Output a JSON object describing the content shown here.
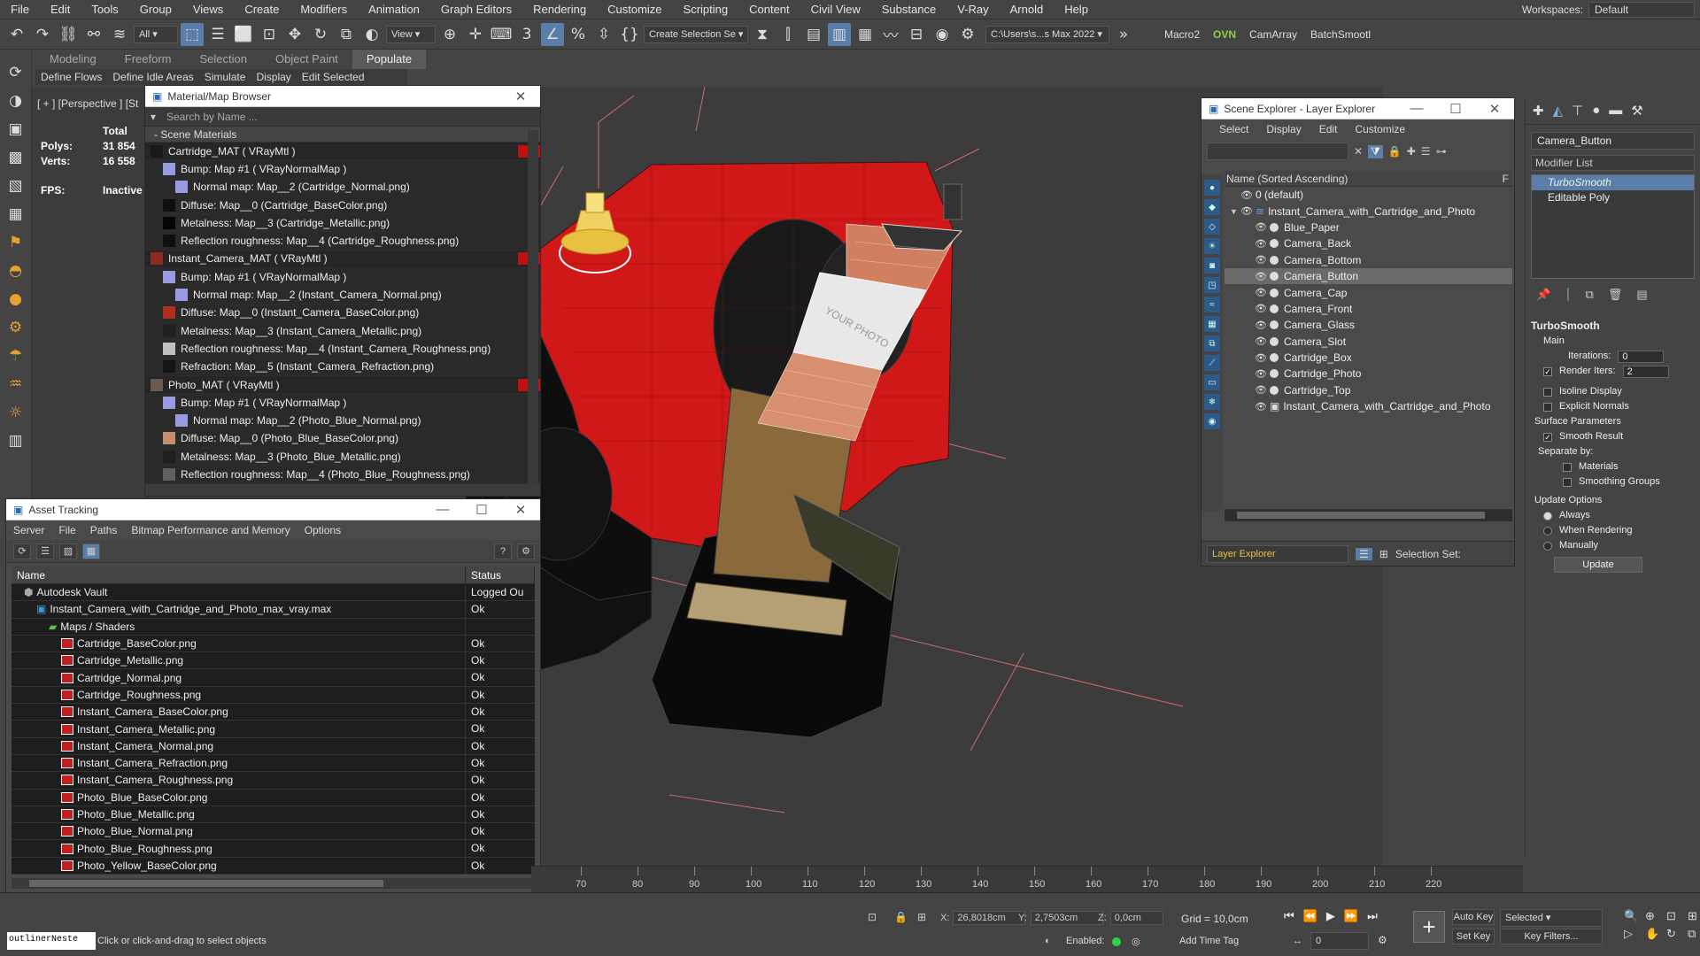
{
  "menubar": {
    "items": [
      "File",
      "Edit",
      "Tools",
      "Group",
      "Views",
      "Create",
      "Modifiers",
      "Animation",
      "Graph Editors",
      "Rendering",
      "Customize",
      "Scripting",
      "Content",
      "Civil View",
      "Substance",
      "V-Ray",
      "Arnold",
      "Help"
    ],
    "workspaces_label": "Workspaces:",
    "workspaces_value": "Default"
  },
  "toolbar": {
    "filter_value": "All",
    "view_value": "View",
    "selection_set": "Create Selection Se",
    "project_path": "C:\\Users\\s...s Max 2022",
    "macro2": "Macro2",
    "ovn": "OVN",
    "camarray": "CamArray",
    "batchsmooth": "BatchSmootl"
  },
  "ribbon": {
    "tabs": [
      "Modeling",
      "Freeform",
      "Selection",
      "Object Paint",
      "Populate"
    ],
    "active_tab": "Populate",
    "subtabs": [
      "Define Flows",
      "Define Idle Areas",
      "Simulate",
      "Display",
      "Edit Selected"
    ]
  },
  "viewport": {
    "label": "[ + ] [Perspective ] [St",
    "stats": {
      "total_label": "Total",
      "polys_label": "Polys:",
      "polys_value": "31 854",
      "verts_label": "Verts:",
      "verts_value": "16 558",
      "fps_label": "FPS:",
      "fps_value": "Inactive"
    },
    "photo_text": "YOUR PHOTO"
  },
  "material_browser": {
    "title": "Material/Map Browser",
    "search_placeholder": "Search by Name ...",
    "section": "- Scene Materials",
    "rows": [
      {
        "text": "Cartridge_MAT  ( VRayMtl )",
        "level": 0,
        "swatch": "#1a1a1a"
      },
      {
        "text": "Bump: Map #1  ( VRayNormalMap )",
        "level": 1,
        "swatch": "#9a9ae0"
      },
      {
        "text": "Normal map: Map__2 (Cartridge_Normal.png)",
        "level": 2,
        "swatch": "#9a9ae0"
      },
      {
        "text": "Diffuse: Map__0 (Cartridge_BaseColor.png)",
        "level": 1,
        "swatch": "#101010"
      },
      {
        "text": "Metalness: Map__3 (Cartridge_Metallic.png)",
        "level": 1,
        "swatch": "#050505"
      },
      {
        "text": "Reflection roughness: Map__4 (Cartridge_Roughness.png)",
        "level": 1,
        "swatch": "#101010"
      },
      {
        "text": "Instant_Camera_MAT  ( VRayMtl )",
        "level": 0,
        "swatch": "#8a2a20"
      },
      {
        "text": "Bump: Map #1  ( VRayNormalMap )",
        "level": 1,
        "swatch": "#9a9ae0"
      },
      {
        "text": "Normal map: Map__2 (Instant_Camera_Normal.png)",
        "level": 2,
        "swatch": "#9a9ae0"
      },
      {
        "text": "Diffuse: Map__0 (Instant_Camera_BaseColor.png)",
        "level": 1,
        "swatch": "#b03020"
      },
      {
        "text": "Metalness: Map__3 (Instant_Camera_Metallic.png)",
        "level": 1,
        "swatch": "#202020"
      },
      {
        "text": "Reflection roughness: Map__4 (Instant_Camera_Roughness.png)",
        "level": 1,
        "swatch": "#c0c0c0"
      },
      {
        "text": "Refraction: Map__5 (Instant_Camera_Refraction.png)",
        "level": 1,
        "swatch": "#151515"
      },
      {
        "text": "Photo_MAT  ( VRayMtl )",
        "level": 0,
        "swatch": "#6a5a50"
      },
      {
        "text": "Bump: Map #1  ( VRayNormalMap )",
        "level": 1,
        "swatch": "#9a9ae0"
      },
      {
        "text": "Normal map: Map__2 (Photo_Blue_Normal.png)",
        "level": 2,
        "swatch": "#9a9ae0"
      },
      {
        "text": "Diffuse: Map__0 (Photo_Blue_BaseColor.png)",
        "level": 1,
        "swatch": "#c09070"
      },
      {
        "text": "Metalness: Map__3 (Photo_Blue_Metallic.png)",
        "level": 1,
        "swatch": "#202020"
      },
      {
        "text": "Reflection roughness: Map__4 (Photo_Blue_Roughness.png)",
        "level": 1,
        "swatch": "#606060"
      }
    ]
  },
  "asset_tracking": {
    "title": "Asset Tracking",
    "menu": [
      "Server",
      "File",
      "Paths",
      "Bitmap Performance and Memory",
      "Options"
    ],
    "columns": [
      "Name",
      "Status"
    ],
    "rows": [
      {
        "name": "Autodesk Vault",
        "status": "Logged Ou",
        "indent": 1,
        "kind": "vault"
      },
      {
        "name": "Instant_Camera_with_Cartridge_and_Photo_max_vray.max",
        "status": "Ok",
        "indent": 2,
        "kind": "max"
      },
      {
        "name": "Maps / Shaders",
        "status": "",
        "indent": 3,
        "kind": "folder"
      },
      {
        "name": "Cartridge_BaseColor.png",
        "status": "Ok",
        "indent": 4,
        "kind": "png"
      },
      {
        "name": "Cartridge_Metallic.png",
        "status": "Ok",
        "indent": 4,
        "kind": "png"
      },
      {
        "name": "Cartridge_Normal.png",
        "status": "Ok",
        "indent": 4,
        "kind": "png"
      },
      {
        "name": "Cartridge_Roughness.png",
        "status": "Ok",
        "indent": 4,
        "kind": "png"
      },
      {
        "name": "Instant_Camera_BaseColor.png",
        "status": "Ok",
        "indent": 4,
        "kind": "png"
      },
      {
        "name": "Instant_Camera_Metallic.png",
        "status": "Ok",
        "indent": 4,
        "kind": "png"
      },
      {
        "name": "Instant_Camera_Normal.png",
        "status": "Ok",
        "indent": 4,
        "kind": "png"
      },
      {
        "name": "Instant_Camera_Refraction.png",
        "status": "Ok",
        "indent": 4,
        "kind": "png"
      },
      {
        "name": "Instant_Camera_Roughness.png",
        "status": "Ok",
        "indent": 4,
        "kind": "png"
      },
      {
        "name": "Photo_Blue_BaseColor.png",
        "status": "Ok",
        "indent": 4,
        "kind": "png"
      },
      {
        "name": "Photo_Blue_Metallic.png",
        "status": "Ok",
        "indent": 4,
        "kind": "png"
      },
      {
        "name": "Photo_Blue_Normal.png",
        "status": "Ok",
        "indent": 4,
        "kind": "png"
      },
      {
        "name": "Photo_Blue_Roughness.png",
        "status": "Ok",
        "indent": 4,
        "kind": "png"
      },
      {
        "name": "Photo_Yellow_BaseColor.png",
        "status": "Ok",
        "indent": 4,
        "kind": "png"
      }
    ]
  },
  "scene_explorer": {
    "title": "Scene Explorer - Layer Explorer",
    "menu": [
      "Select",
      "Display",
      "Edit",
      "Customize"
    ],
    "column_header": "Name (Sorted Ascending)",
    "column_header_right": "F",
    "rows": [
      {
        "name": "0 (default)",
        "level": 1,
        "selected": false
      },
      {
        "name": "Instant_Camera_with_Cartridge_and_Photo",
        "level": 1,
        "selected": false,
        "layer": true
      },
      {
        "name": "Blue_Paper",
        "level": 2,
        "selected": false
      },
      {
        "name": "Camera_Back",
        "level": 2,
        "selected": false
      },
      {
        "name": "Camera_Bottom",
        "level": 2,
        "selected": false
      },
      {
        "name": "Camera_Button",
        "level": 2,
        "selected": true
      },
      {
        "name": "Camera_Cap",
        "level": 2,
        "selected": false
      },
      {
        "name": "Camera_Front",
        "level": 2,
        "selected": false
      },
      {
        "name": "Camera_Glass",
        "level": 2,
        "selected": false
      },
      {
        "name": "Camera_Slot",
        "level": 2,
        "selected": false
      },
      {
        "name": "Cartridge_Box",
        "level": 2,
        "selected": false
      },
      {
        "name": "Cartridge_Photo",
        "level": 2,
        "selected": false
      },
      {
        "name": "Cartridge_Top",
        "level": 2,
        "selected": false
      },
      {
        "name": "Instant_Camera_with_Cartridge_and_Photo",
        "level": 2,
        "selected": false,
        "group": true
      }
    ],
    "footer_explorer": "Layer Explorer",
    "footer_selection_set": "Selection Set:"
  },
  "command_panel": {
    "object_name": "Camera_Button",
    "modifier_list": "Modifier List",
    "stack": [
      "TurboSmooth",
      "Editable Poly"
    ],
    "turbosmooth": {
      "title": "TurboSmooth",
      "main": "Main",
      "iterations_label": "Iterations:",
      "iterations_value": "0",
      "render_iters_label": "Render Iters:",
      "render_iters_value": "2",
      "isoline": "Isoline Display",
      "explicit_normals": "Explicit Normals",
      "surface_params": "Surface Parameters",
      "smooth_result": "Smooth Result",
      "separate_by": "Separate by:",
      "materials": "Materials",
      "smoothing_groups": "Smoothing Groups",
      "update_options": "Update Options",
      "always": "Always",
      "when_rendering": "When Rendering",
      "manually": "Manually",
      "update_button": "Update"
    }
  },
  "timeline": {
    "ticks": [
      "70",
      "80",
      "90",
      "100",
      "110",
      "120",
      "130",
      "140",
      "150",
      "160",
      "170",
      "180",
      "190",
      "200",
      "210",
      "220"
    ]
  },
  "status_bar": {
    "maxscript": "outlinerNeste",
    "prompt": "Click or click-and-drag to select objects",
    "x_label": "X:",
    "x_value": "26,8018cm",
    "y_label": "Y:",
    "y_value": "2,7503cm",
    "z_label": "Z:",
    "z_value": "0,0cm",
    "grid": "Grid = 10,0cm",
    "enabled_label": "Enabled:",
    "add_time_tag": "Add Time Tag",
    "auto_key": "Auto Key",
    "set_key": "Set Key",
    "selected_value": "Selected",
    "key_filters": "Key Filters...",
    "frame_value": "0"
  }
}
